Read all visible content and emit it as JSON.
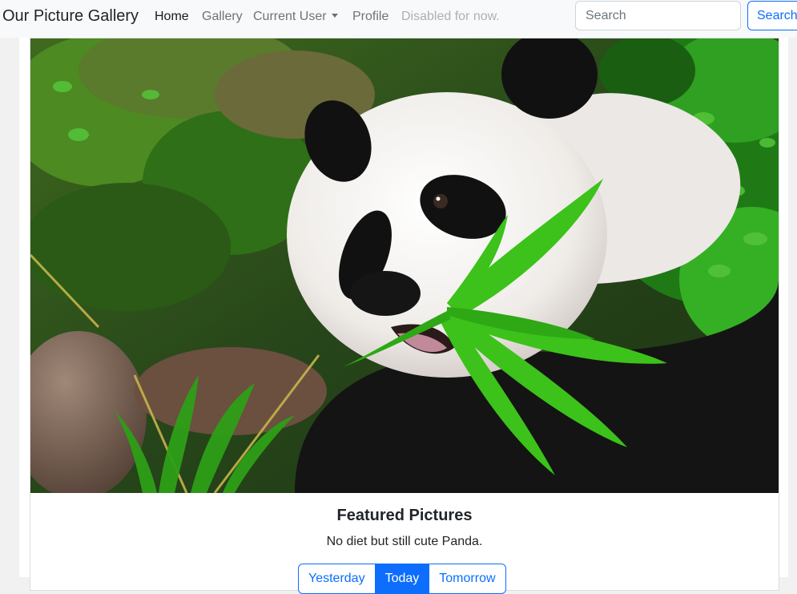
{
  "navbar": {
    "brand": "Our Picture Gallery",
    "items": [
      {
        "label": "Home",
        "state": "active"
      },
      {
        "label": "Gallery",
        "state": "normal"
      },
      {
        "label": "Current User",
        "state": "dropdown"
      },
      {
        "label": "Profile",
        "state": "normal"
      },
      {
        "label": "Disabled for now.",
        "state": "disabled"
      }
    ],
    "search": {
      "placeholder": "Search",
      "value": ""
    },
    "search_button": "Search"
  },
  "card": {
    "image_subject": "panda eating bamboo",
    "title": "Featured Pictures",
    "text": "No diet but still cute Panda.",
    "buttons": [
      {
        "label": "Yesterday",
        "active": false
      },
      {
        "label": "Today",
        "active": true
      },
      {
        "label": "Tomorrow",
        "active": false
      }
    ]
  },
  "colors": {
    "primary": "#0d6efd",
    "navbar_bg": "#f8f9fa",
    "panda_white": "#f4f2f0",
    "panda_black": "#141414",
    "foliage": "#2f7d1c",
    "bamboo_leaf": "#3cc21a"
  }
}
